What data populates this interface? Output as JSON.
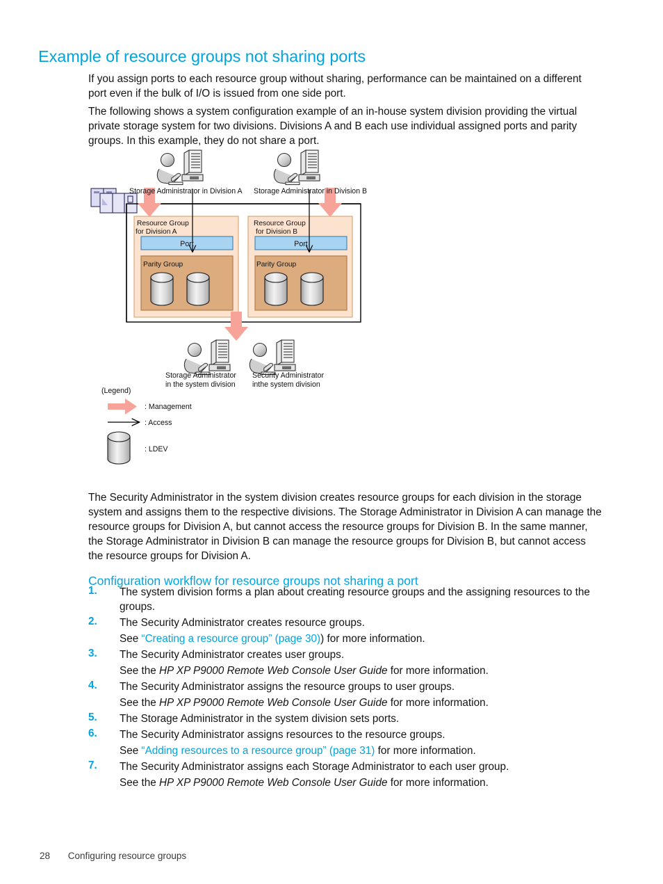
{
  "page": {
    "heading": "Example of resource groups not sharing ports",
    "paragraph1": "If you assign ports to each resource group without sharing, performance can be maintained on a different port even if the bulk of I/O is issued from one side port.",
    "paragraph2": "The following shows a system configuration example of an in-house system division providing the virtual private storage system for two divisions. Divisions A and B each use individual assigned ports and parity groups. In this example, they do not share a port.",
    "paragraph3": "The Security Administrator in the system division creates resource groups for each division in the storage system and assigns them to the respective divisions. The Storage Administrator in Division A can manage the resource groups for Division A, but cannot access the resource groups for Division B. In the same manner, the Storage Administrator in Division B can manage the resource groups for Division B, but cannot access the resource groups for Division A.",
    "subheading": "Configuration workflow for resource groups not sharing a port"
  },
  "steps": [
    {
      "num": "1.",
      "text": "The system division forms a plan about creating resource groups and the assigning resources to the groups.",
      "sub": null
    },
    {
      "num": "2.",
      "text": "The Security Administrator creates resource groups.",
      "sub_pre": "See ",
      "sub_link": "“Creating a resource group” (page 30)",
      "sub_post": ") for more information."
    },
    {
      "num": "3.",
      "text": "The Security Administrator creates user groups.",
      "sub_pre": "See the ",
      "sub_italic": "HP XP P9000 Remote Web Console User Guide",
      "sub_post": " for more information."
    },
    {
      "num": "4.",
      "text": "The Security Administrator assigns the resource groups to user groups.",
      "sub_pre": "See the ",
      "sub_italic": "HP XP P9000 Remote Web Console User Guide",
      "sub_post": " for more information."
    },
    {
      "num": "5.",
      "text": "The Storage Administrator in the system division sets ports.",
      "sub": null
    },
    {
      "num": "6.",
      "text": "The Security Administrator assigns resources to the resource groups.",
      "sub_pre": "See ",
      "sub_link": "“Adding resources to a resource group” (page 31)",
      "sub_post": " for more information."
    },
    {
      "num": "7.",
      "text": "The Security Administrator assigns each Storage Administrator to each user group.",
      "sub_pre": "See the ",
      "sub_italic": "HP XP P9000 Remote Web Console User Guide",
      "sub_post": " for more information."
    }
  ],
  "footer": {
    "page_number": "28",
    "chapter": "Configuring resource groups"
  },
  "figure": {
    "admin_top_left": "Storage Administrator in Division A",
    "admin_top_right": "Storage Administrator in Division B",
    "group_a_line1": "Resource Group",
    "group_a_line2": "for Division A",
    "group_b_line1": "Resource Group",
    "group_b_line2": "for Division B",
    "port_a": "Port",
    "port_b": "Port",
    "parity_a": "Parity Group",
    "parity_b": "Parity Group",
    "admin_bottom_left_line1": "Storage Administrator",
    "admin_bottom_left_line2": "in the system division",
    "admin_bottom_right_line1": "Security Administrator",
    "admin_bottom_right_line2": "inthe system division",
    "legend_title": "(Legend)",
    "legend_management": ": Management",
    "legend_access": ": Access",
    "legend_ldev": ": LDEV",
    "colors": {
      "accent_link": "#00a5e0",
      "arrow_pink": "#f7a39a",
      "resource_group_fill": "#fbe3d0",
      "parity_group_fill": "#dcab7e",
      "port_fill": "#a8d4f2",
      "array_fill": "#d8d8f0",
      "cylinder_fill": "#d9d9d9"
    }
  }
}
